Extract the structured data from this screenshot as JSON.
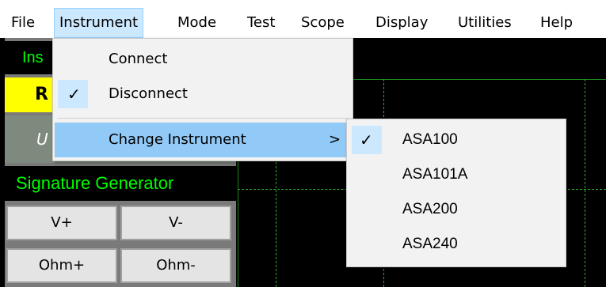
{
  "menubar": {
    "items": [
      {
        "label": "File"
      },
      {
        "label": "Instrument"
      },
      {
        "label": "Mode"
      },
      {
        "label": "Test"
      },
      {
        "label": "Scope"
      },
      {
        "label": "Display"
      },
      {
        "label": "Utilities"
      },
      {
        "label": "Help"
      }
    ],
    "active": "Instrument"
  },
  "background": {
    "panel_title_partial": "Ins",
    "yellow_partial": "R",
    "gray_partial": "U",
    "signature_generator": "Signature Generator",
    "buttons": [
      {
        "label": "V+"
      },
      {
        "label": "V-"
      },
      {
        "label": "Ohm+"
      },
      {
        "label": "Ohm-"
      }
    ]
  },
  "instrument_menu": {
    "items": [
      {
        "label": "Connect",
        "checked": false
      },
      {
        "label": "Disconnect",
        "checked": true
      },
      {
        "label": "Change Instrument",
        "submenu_arrow": ">",
        "highlighted": true
      }
    ],
    "check_glyph": "✓"
  },
  "change_instrument_submenu": {
    "items": [
      {
        "label": "ASA100",
        "checked": true
      },
      {
        "label": "ASA101A",
        "checked": false
      },
      {
        "label": "ASA200",
        "checked": false
      },
      {
        "label": "ASA240",
        "checked": false
      }
    ]
  },
  "colors": {
    "menu_highlight": "#91c9f7",
    "active_menu": "#cce8ff",
    "scope_grid": "#2fae2f",
    "signal_green": "#00ff00",
    "yellow_bar": "#ffff00"
  }
}
